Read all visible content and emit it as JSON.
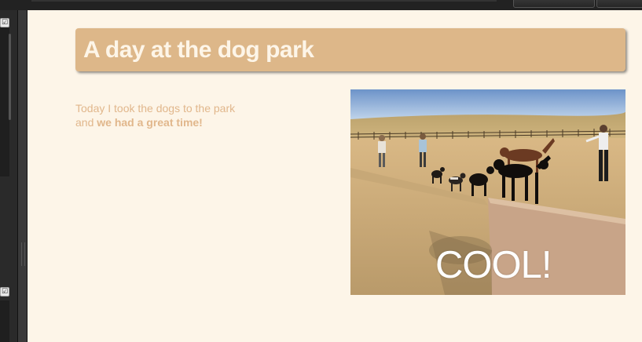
{
  "page": {
    "title": "A day at the dog park",
    "body_plain": "Today I took the dogs to the park and ",
    "body_bold": "we had a great time!"
  },
  "photo": {
    "caption": "COOL!",
    "subject": "dog-park-photo"
  },
  "editor": {
    "checkbox_mark": "☑"
  },
  "colors": {
    "page_background": "#fdf5e8",
    "title_background": "#ddb789",
    "title_text": "#fdf5e8",
    "body_text": "#e1b78c",
    "editor_chrome": "#2a2a2a"
  }
}
